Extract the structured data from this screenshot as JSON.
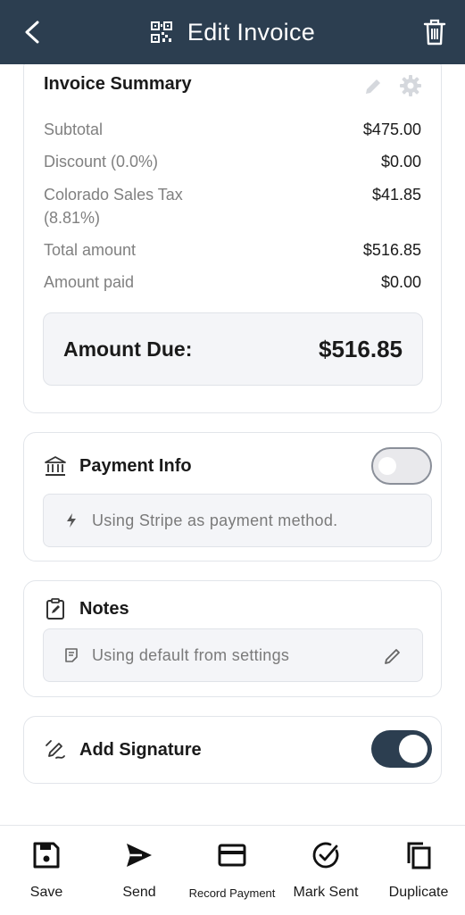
{
  "header": {
    "title": "Edit Invoice"
  },
  "summary": {
    "title": "Invoice Summary",
    "rows": [
      {
        "label": "Subtotal",
        "value": "$475.00"
      },
      {
        "label": "Discount (0.0%)",
        "value": "$0.00"
      },
      {
        "label": "Colorado Sales Tax (8.81%)",
        "value": "$41.85"
      },
      {
        "label": "Total amount",
        "value": "$516.85"
      },
      {
        "label": "Amount paid",
        "value": "$0.00"
      }
    ],
    "due_label": "Amount Due:",
    "due_value": "$516.85"
  },
  "payment": {
    "title": "Payment Info",
    "enabled": false,
    "info": "Using Stripe as payment method."
  },
  "notes": {
    "title": "Notes",
    "info": "Using default from settings"
  },
  "signature": {
    "title": "Add Signature",
    "enabled": true
  },
  "bottom_bar": {
    "save": "Save",
    "send": "Send",
    "record_payment": "Record Payment",
    "mark_sent": "Mark Sent",
    "duplicate": "Duplicate"
  },
  "colors": {
    "header_bg": "#2c3e50",
    "toggle_on": "#2c3e50",
    "label_gray": "#808080"
  }
}
